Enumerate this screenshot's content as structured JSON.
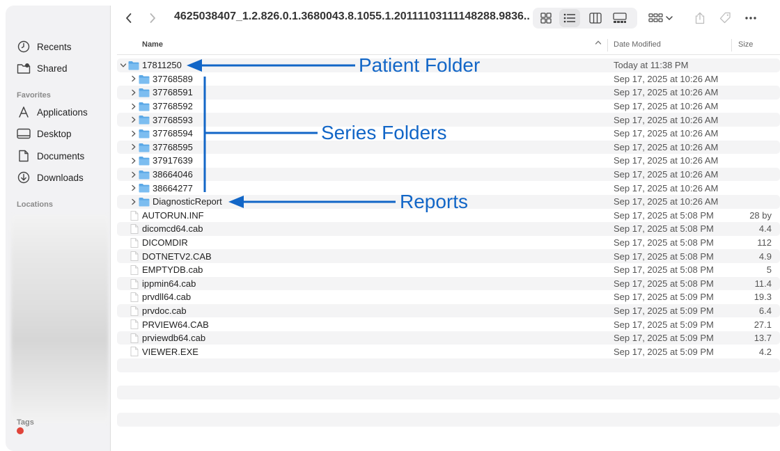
{
  "sidebar": {
    "top_items": [
      {
        "label": "Recents",
        "icon": "clock-icon"
      },
      {
        "label": "Shared",
        "icon": "shared-folder-icon"
      }
    ],
    "favorites_heading": "Favorites",
    "favorites": [
      {
        "label": "Applications",
        "icon": "applications-icon"
      },
      {
        "label": "Desktop",
        "icon": "desktop-icon"
      },
      {
        "label": "Documents",
        "icon": "document-icon"
      },
      {
        "label": "Downloads",
        "icon": "download-icon"
      }
    ],
    "locations_heading": "Locations",
    "tags_heading": "Tags"
  },
  "toolbar": {
    "path_title": "4625038407_1.2.826.0.1.3680043.8.1055.1.20111103111148288.9836...",
    "active_view": "list"
  },
  "columns": {
    "name": "Name",
    "date_modified": "Date Modified",
    "size": "Size"
  },
  "rows": [
    {
      "name": "17811250",
      "type": "folder",
      "level": 0,
      "expanded": true,
      "date": "Today at 11:38 PM",
      "size": ""
    },
    {
      "name": "37768589",
      "type": "folder",
      "level": 1,
      "expanded": false,
      "date": "Sep 17, 2025 at 10:26 AM",
      "size": ""
    },
    {
      "name": "37768591",
      "type": "folder",
      "level": 1,
      "expanded": false,
      "date": "Sep 17, 2025 at 10:26 AM",
      "size": ""
    },
    {
      "name": "37768592",
      "type": "folder",
      "level": 1,
      "expanded": false,
      "date": "Sep 17, 2025 at 10:26 AM",
      "size": ""
    },
    {
      "name": "37768593",
      "type": "folder",
      "level": 1,
      "expanded": false,
      "date": "Sep 17, 2025 at 10:26 AM",
      "size": ""
    },
    {
      "name": "37768594",
      "type": "folder",
      "level": 1,
      "expanded": false,
      "date": "Sep 17, 2025 at 10:26 AM",
      "size": ""
    },
    {
      "name": "37768595",
      "type": "folder",
      "level": 1,
      "expanded": false,
      "date": "Sep 17, 2025 at 10:26 AM",
      "size": ""
    },
    {
      "name": "37917639",
      "type": "folder",
      "level": 1,
      "expanded": false,
      "date": "Sep 17, 2025 at 10:26 AM",
      "size": ""
    },
    {
      "name": "38664046",
      "type": "folder",
      "level": 1,
      "expanded": false,
      "date": "Sep 17, 2025 at 10:26 AM",
      "size": ""
    },
    {
      "name": "38664277",
      "type": "folder",
      "level": 1,
      "expanded": false,
      "date": "Sep 17, 2025 at 10:26 AM",
      "size": ""
    },
    {
      "name": "DiagnosticReport",
      "type": "folder",
      "level": 1,
      "expanded": false,
      "date": "Sep 17, 2025 at 10:26 AM",
      "size": ""
    },
    {
      "name": "AUTORUN.INF",
      "type": "file",
      "level": 0,
      "date": "Sep 17, 2025 at 5:08 PM",
      "size": "28 by"
    },
    {
      "name": "dicomcd64.cab",
      "type": "file",
      "level": 0,
      "date": "Sep 17, 2025 at 5:08 PM",
      "size": "4.4"
    },
    {
      "name": "DICOMDIR",
      "type": "file",
      "level": 0,
      "date": "Sep 17, 2025 at 5:08 PM",
      "size": "112"
    },
    {
      "name": "DOTNETV2.CAB",
      "type": "file",
      "level": 0,
      "date": "Sep 17, 2025 at 5:08 PM",
      "size": "4.9"
    },
    {
      "name": "EMPTYDB.cab",
      "type": "file",
      "level": 0,
      "date": "Sep 17, 2025 at 5:08 PM",
      "size": "5"
    },
    {
      "name": "ippmin64.cab",
      "type": "file",
      "level": 0,
      "date": "Sep 17, 2025 at 5:08 PM",
      "size": "11.4"
    },
    {
      "name": "prvdll64.cab",
      "type": "file",
      "level": 0,
      "date": "Sep 17, 2025 at 5:09 PM",
      "size": "19.3"
    },
    {
      "name": "prvdoc.cab",
      "type": "file",
      "level": 0,
      "date": "Sep 17, 2025 at 5:09 PM",
      "size": "6.4"
    },
    {
      "name": "PRVIEW64.CAB",
      "type": "file",
      "level": 0,
      "date": "Sep 17, 2025 at 5:09 PM",
      "size": "27.1"
    },
    {
      "name": "prviewdb64.cab",
      "type": "file",
      "level": 0,
      "date": "Sep 17, 2025 at 5:09 PM",
      "size": "13.7"
    },
    {
      "name": "VIEWER.EXE",
      "type": "file",
      "level": 0,
      "date": "Sep 17, 2025 at 5:09 PM",
      "size": "4.2"
    }
  ],
  "annotations": {
    "patient_folder": "Patient Folder",
    "series_folders": "Series Folders",
    "reports": "Reports",
    "color": "#1266c7"
  },
  "colors": {
    "folder": "#5ba8e6",
    "row_alt": "#f4f4f5",
    "tag_red": "#e0443a"
  }
}
